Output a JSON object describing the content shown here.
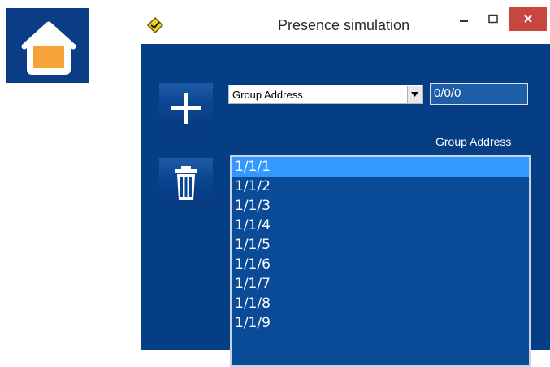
{
  "home_tile": {
    "icon": "home-icon",
    "colors": {
      "background": "#0b3d86",
      "house_outline": "#ffffff",
      "house_fill": "#f6a43a"
    }
  },
  "window": {
    "title": "Presence simulation",
    "app_icon": "app-logo-icon",
    "controls": {
      "minimize_icon": "minimize-icon",
      "maximize_icon": "maximize-icon",
      "close_icon": "close-icon",
      "close_color": "#c7463f"
    },
    "background": "#063e86"
  },
  "toolbar": {
    "add_icon": "plus-icon",
    "delete_icon": "trash-icon"
  },
  "group_select": {
    "selected": "Group Address",
    "arrow_icon": "chevron-down-icon"
  },
  "address_input": {
    "value": "0/0/0"
  },
  "list": {
    "label": "Group Address",
    "items": [
      "1/1/1",
      "1/1/2",
      "1/1/3",
      "1/1/4",
      "1/1/5",
      "1/1/6",
      "1/1/7",
      "1/1/8",
      "1/1/9"
    ],
    "selected_index": 0
  }
}
